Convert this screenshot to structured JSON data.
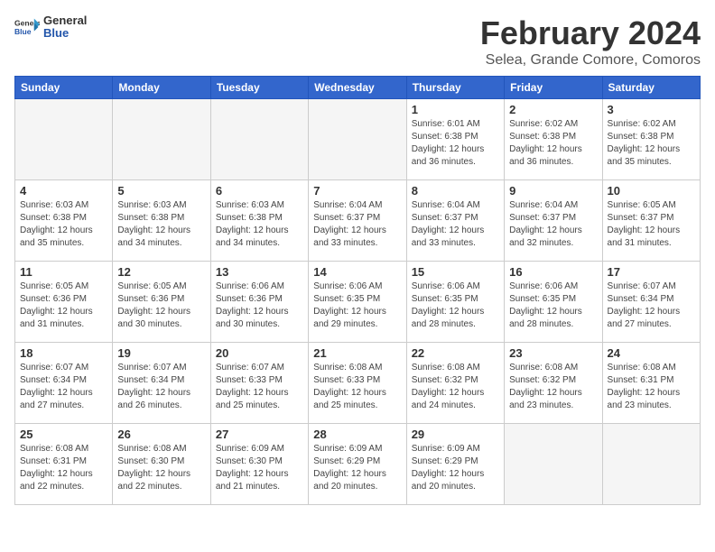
{
  "header": {
    "logo_general": "General",
    "logo_blue": "Blue",
    "title": "February 2024",
    "subtitle": "Selea, Grande Comore, Comoros"
  },
  "weekdays": [
    "Sunday",
    "Monday",
    "Tuesday",
    "Wednesday",
    "Thursday",
    "Friday",
    "Saturday"
  ],
  "weeks": [
    [
      {
        "day": "",
        "info": ""
      },
      {
        "day": "",
        "info": ""
      },
      {
        "day": "",
        "info": ""
      },
      {
        "day": "",
        "info": ""
      },
      {
        "day": "1",
        "info": "Sunrise: 6:01 AM\nSunset: 6:38 PM\nDaylight: 12 hours\nand 36 minutes."
      },
      {
        "day": "2",
        "info": "Sunrise: 6:02 AM\nSunset: 6:38 PM\nDaylight: 12 hours\nand 36 minutes."
      },
      {
        "day": "3",
        "info": "Sunrise: 6:02 AM\nSunset: 6:38 PM\nDaylight: 12 hours\nand 35 minutes."
      }
    ],
    [
      {
        "day": "4",
        "info": "Sunrise: 6:03 AM\nSunset: 6:38 PM\nDaylight: 12 hours\nand 35 minutes."
      },
      {
        "day": "5",
        "info": "Sunrise: 6:03 AM\nSunset: 6:38 PM\nDaylight: 12 hours\nand 34 minutes."
      },
      {
        "day": "6",
        "info": "Sunrise: 6:03 AM\nSunset: 6:38 PM\nDaylight: 12 hours\nand 34 minutes."
      },
      {
        "day": "7",
        "info": "Sunrise: 6:04 AM\nSunset: 6:37 PM\nDaylight: 12 hours\nand 33 minutes."
      },
      {
        "day": "8",
        "info": "Sunrise: 6:04 AM\nSunset: 6:37 PM\nDaylight: 12 hours\nand 33 minutes."
      },
      {
        "day": "9",
        "info": "Sunrise: 6:04 AM\nSunset: 6:37 PM\nDaylight: 12 hours\nand 32 minutes."
      },
      {
        "day": "10",
        "info": "Sunrise: 6:05 AM\nSunset: 6:37 PM\nDaylight: 12 hours\nand 31 minutes."
      }
    ],
    [
      {
        "day": "11",
        "info": "Sunrise: 6:05 AM\nSunset: 6:36 PM\nDaylight: 12 hours\nand 31 minutes."
      },
      {
        "day": "12",
        "info": "Sunrise: 6:05 AM\nSunset: 6:36 PM\nDaylight: 12 hours\nand 30 minutes."
      },
      {
        "day": "13",
        "info": "Sunrise: 6:06 AM\nSunset: 6:36 PM\nDaylight: 12 hours\nand 30 minutes."
      },
      {
        "day": "14",
        "info": "Sunrise: 6:06 AM\nSunset: 6:35 PM\nDaylight: 12 hours\nand 29 minutes."
      },
      {
        "day": "15",
        "info": "Sunrise: 6:06 AM\nSunset: 6:35 PM\nDaylight: 12 hours\nand 28 minutes."
      },
      {
        "day": "16",
        "info": "Sunrise: 6:06 AM\nSunset: 6:35 PM\nDaylight: 12 hours\nand 28 minutes."
      },
      {
        "day": "17",
        "info": "Sunrise: 6:07 AM\nSunset: 6:34 PM\nDaylight: 12 hours\nand 27 minutes."
      }
    ],
    [
      {
        "day": "18",
        "info": "Sunrise: 6:07 AM\nSunset: 6:34 PM\nDaylight: 12 hours\nand 27 minutes."
      },
      {
        "day": "19",
        "info": "Sunrise: 6:07 AM\nSunset: 6:34 PM\nDaylight: 12 hours\nand 26 minutes."
      },
      {
        "day": "20",
        "info": "Sunrise: 6:07 AM\nSunset: 6:33 PM\nDaylight: 12 hours\nand 25 minutes."
      },
      {
        "day": "21",
        "info": "Sunrise: 6:08 AM\nSunset: 6:33 PM\nDaylight: 12 hours\nand 25 minutes."
      },
      {
        "day": "22",
        "info": "Sunrise: 6:08 AM\nSunset: 6:32 PM\nDaylight: 12 hours\nand 24 minutes."
      },
      {
        "day": "23",
        "info": "Sunrise: 6:08 AM\nSunset: 6:32 PM\nDaylight: 12 hours\nand 23 minutes."
      },
      {
        "day": "24",
        "info": "Sunrise: 6:08 AM\nSunset: 6:31 PM\nDaylight: 12 hours\nand 23 minutes."
      }
    ],
    [
      {
        "day": "25",
        "info": "Sunrise: 6:08 AM\nSunset: 6:31 PM\nDaylight: 12 hours\nand 22 minutes."
      },
      {
        "day": "26",
        "info": "Sunrise: 6:08 AM\nSunset: 6:30 PM\nDaylight: 12 hours\nand 22 minutes."
      },
      {
        "day": "27",
        "info": "Sunrise: 6:09 AM\nSunset: 6:30 PM\nDaylight: 12 hours\nand 21 minutes."
      },
      {
        "day": "28",
        "info": "Sunrise: 6:09 AM\nSunset: 6:29 PM\nDaylight: 12 hours\nand 20 minutes."
      },
      {
        "day": "29",
        "info": "Sunrise: 6:09 AM\nSunset: 6:29 PM\nDaylight: 12 hours\nand 20 minutes."
      },
      {
        "day": "",
        "info": ""
      },
      {
        "day": "",
        "info": ""
      }
    ]
  ]
}
